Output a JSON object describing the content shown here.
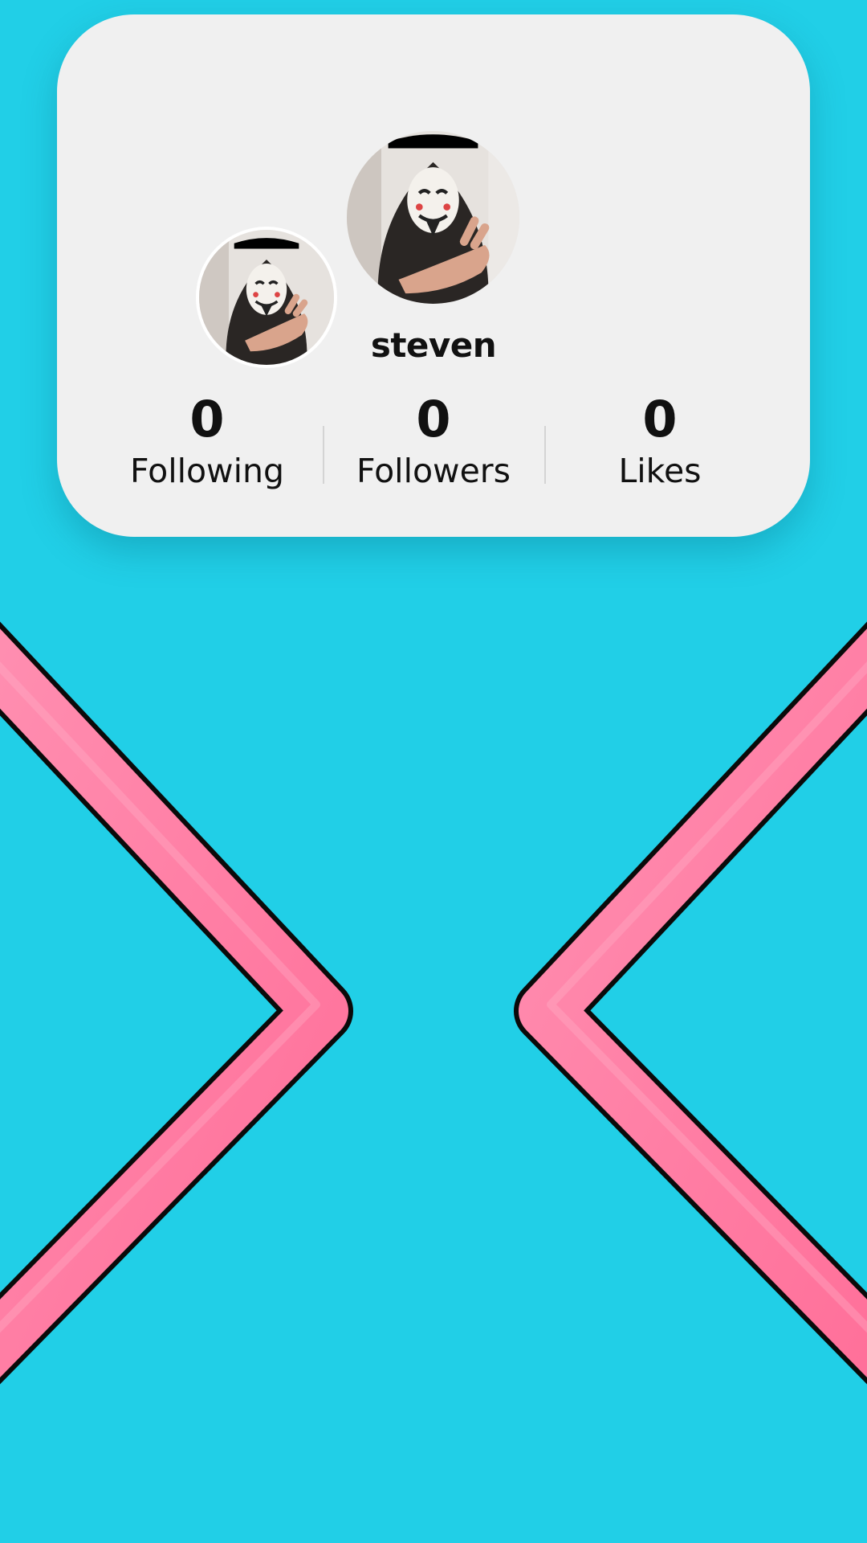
{
  "profile": {
    "username": "steven",
    "avatar_icon": "masked-person-avatar"
  },
  "stats": {
    "following": {
      "value": "0",
      "label": "Following"
    },
    "followers": {
      "value": "0",
      "label": "Followers"
    },
    "likes": {
      "value": "0",
      "label": "Likes"
    }
  },
  "colors": {
    "background": "#21cfe7",
    "card": "#f0f0f0",
    "chevron": "#ff7aa2",
    "outline": "#0a0a0a"
  }
}
